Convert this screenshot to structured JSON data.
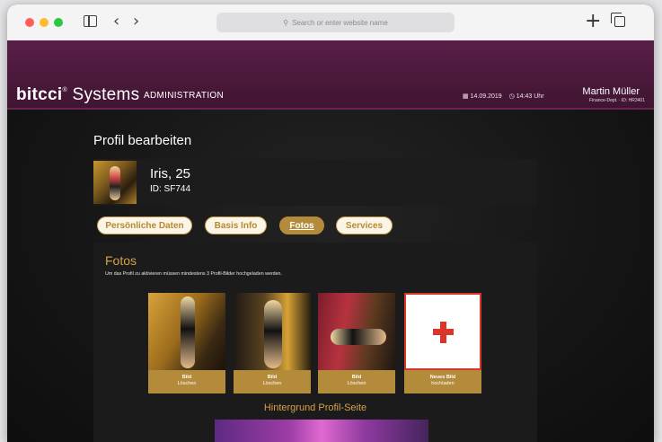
{
  "browser": {
    "address_placeholder": "Search or enter website name",
    "icons": {
      "sidebar": "sidebar-icon",
      "back": "chevron-left-icon",
      "forward": "chevron-right-icon",
      "search": "search-icon",
      "new_tab": "plus-icon",
      "tabs": "tabs-overview-icon"
    }
  },
  "header": {
    "logo_bold": "bitcci",
    "logo_mark": "®",
    "logo_rest": "Systems",
    "section": "ADMINISTRATION",
    "date": "14.09.2019",
    "time": "14:43 Uhr",
    "user_name": "Martin Müller",
    "user_meta": "Finance-Dept. · ID: HR3401"
  },
  "page": {
    "title": "Profil bearbeiten",
    "profile": {
      "name": "Iris, 25",
      "id": "ID: SF744"
    },
    "tabs": [
      {
        "label": "Persönliche Daten",
        "active": false
      },
      {
        "label": "Basis Info",
        "active": false
      },
      {
        "label": "Fotos",
        "active": true
      },
      {
        "label": "Services",
        "active": false
      }
    ],
    "fotos": {
      "title": "Fotos",
      "hint": "Um das Profil zu aktivieren müssen mindestens 3 Profil-Bilder hochgeladen werden.",
      "photos": [
        {
          "label": "Bild",
          "action": "Löschen"
        },
        {
          "label": "Bild",
          "action": "Löschen"
        },
        {
          "label": "Bild",
          "action": "Löschen"
        }
      ],
      "new_photo": {
        "label": "Neues Bild",
        "action": "hochladen"
      },
      "background_title": "Hintergrund Profil-Seite"
    }
  },
  "colors": {
    "header": "#4a1a3d",
    "accent_gold": "#b38b3a",
    "title_gold": "#d6a146",
    "upload_red": "#d9362a"
  }
}
